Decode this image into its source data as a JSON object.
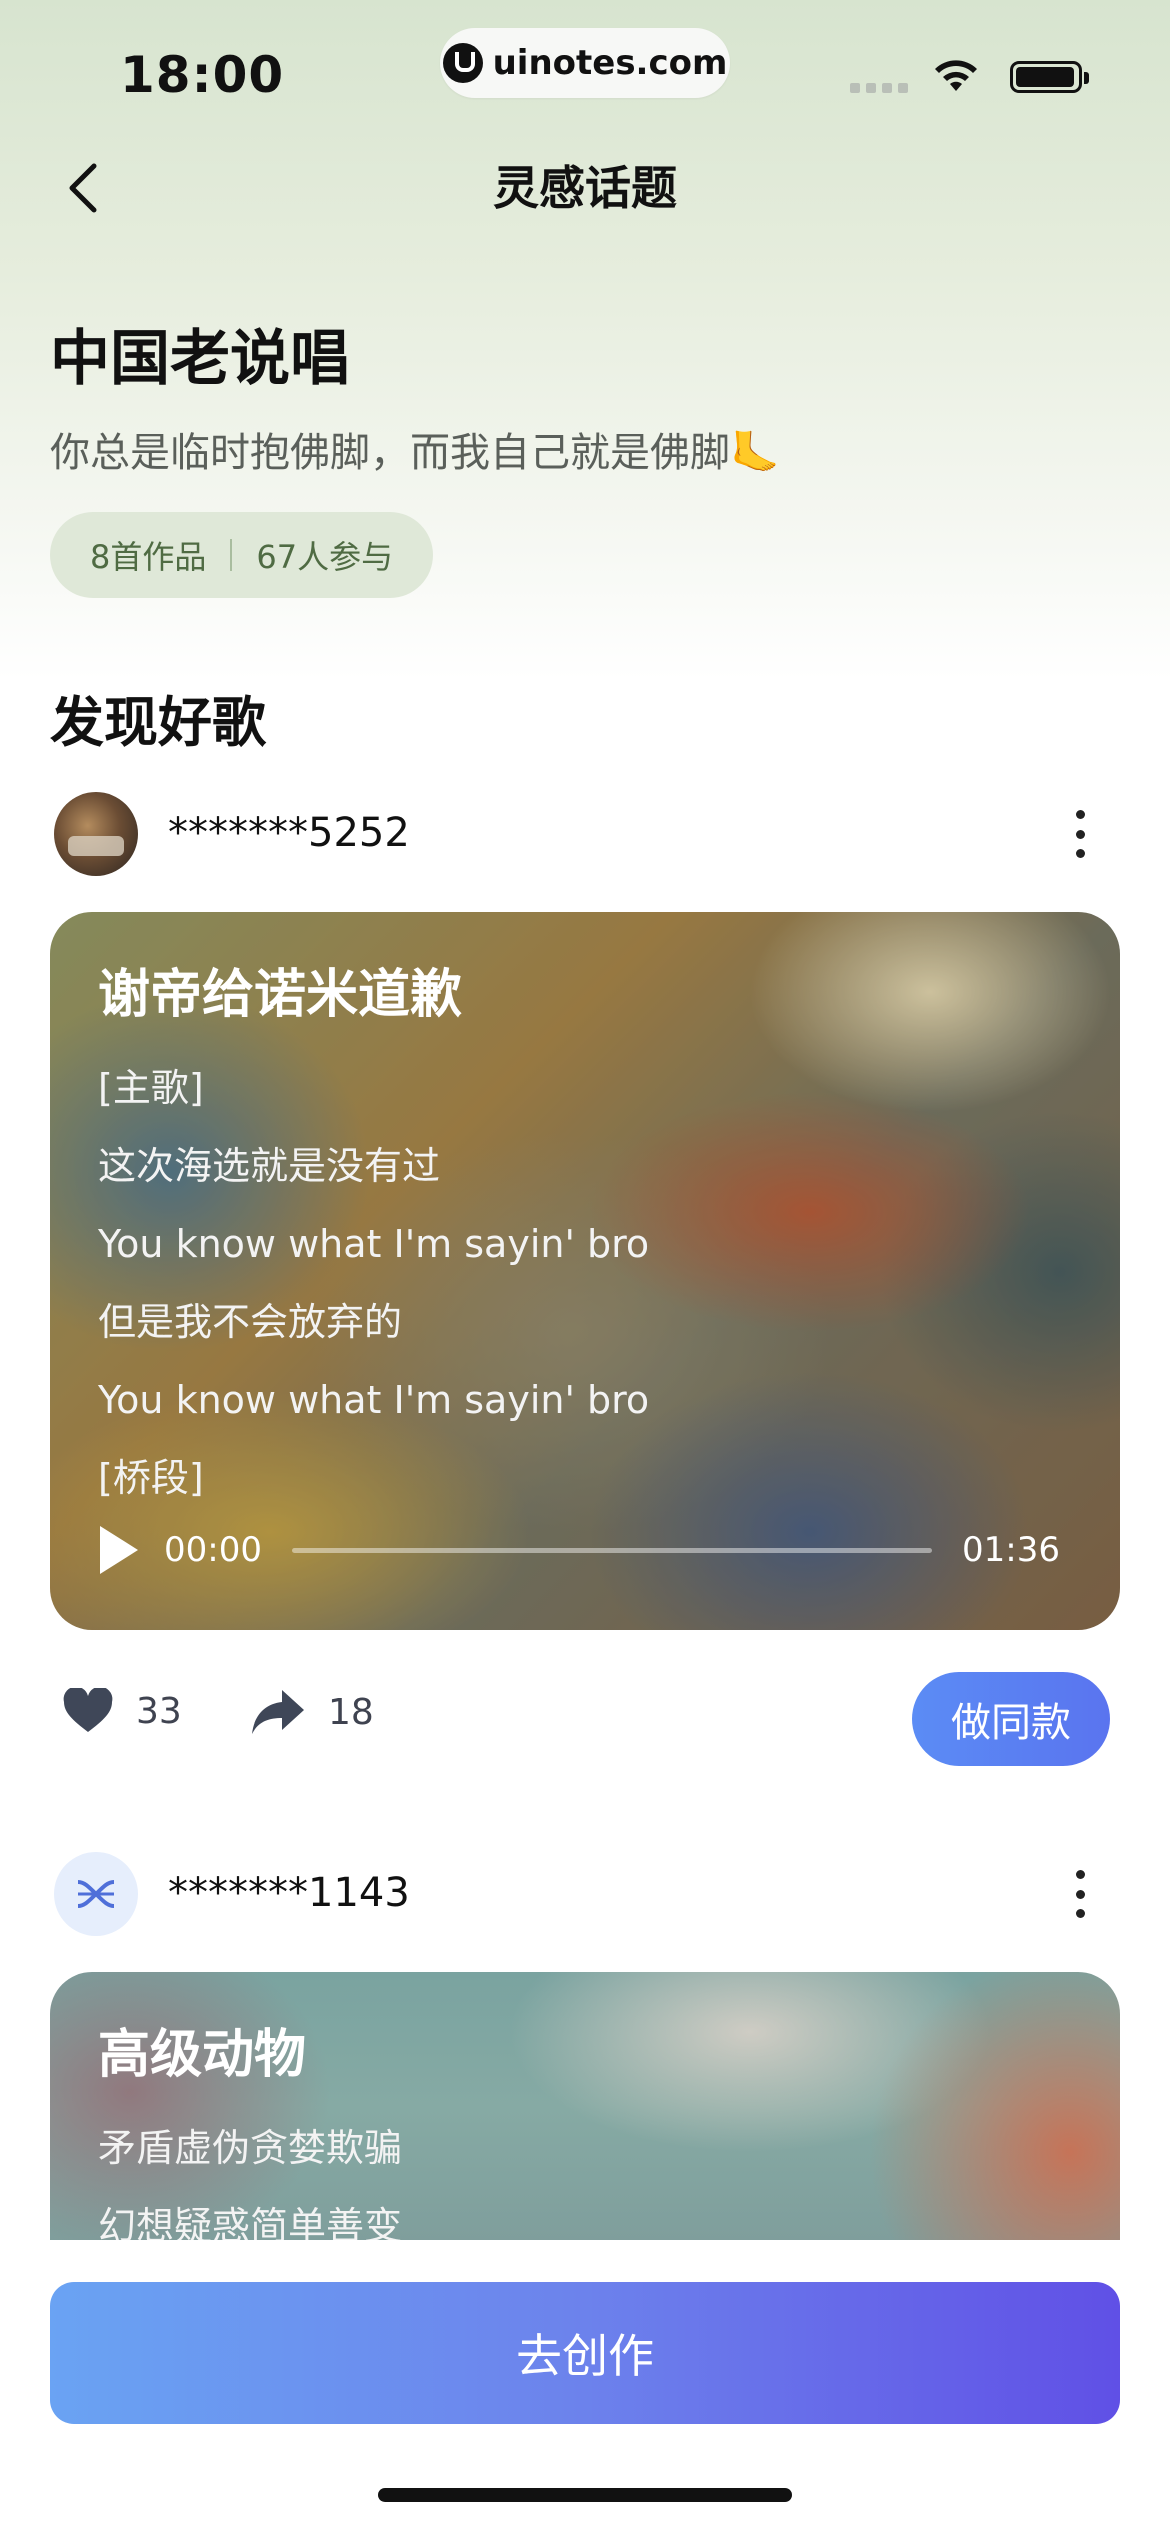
{
  "status_bar": {
    "time": "18:00",
    "url": "uinotes.com"
  },
  "nav": {
    "title": "灵感话题",
    "back_icon": "chevron-left-icon"
  },
  "topic": {
    "title": "中国老说唱",
    "subtitle": "你总是临时抱佛脚，而我自己就是佛脚🦶",
    "works": "8首作品",
    "participants": "67人参与"
  },
  "section_title": "发现好歌",
  "posts": [
    {
      "username": "*******5252",
      "song_title": "谢帝给诺米道歉",
      "lyrics": [
        "[主歌]",
        "这次海选就是没有过",
        "You know what I'm sayin' bro",
        "但是我不会放弃的",
        "You know what I'm sayin' bro",
        "[桥段]"
      ],
      "current_time": "00:00",
      "duration": "01:36",
      "progress": 0,
      "likes": "33",
      "shares": "18",
      "make_same_label": "做同款"
    },
    {
      "username": "*******1143",
      "song_title": "高级动物",
      "lyrics": [
        "矛盾虚伪贪婪欺骗",
        "幻想疑惑简单善变"
      ]
    }
  ],
  "create_button": "去创作",
  "colors": {
    "accent": "#5a7bef",
    "stats_bg": "#dfe8d8",
    "stats_text": "#4f6b43"
  }
}
